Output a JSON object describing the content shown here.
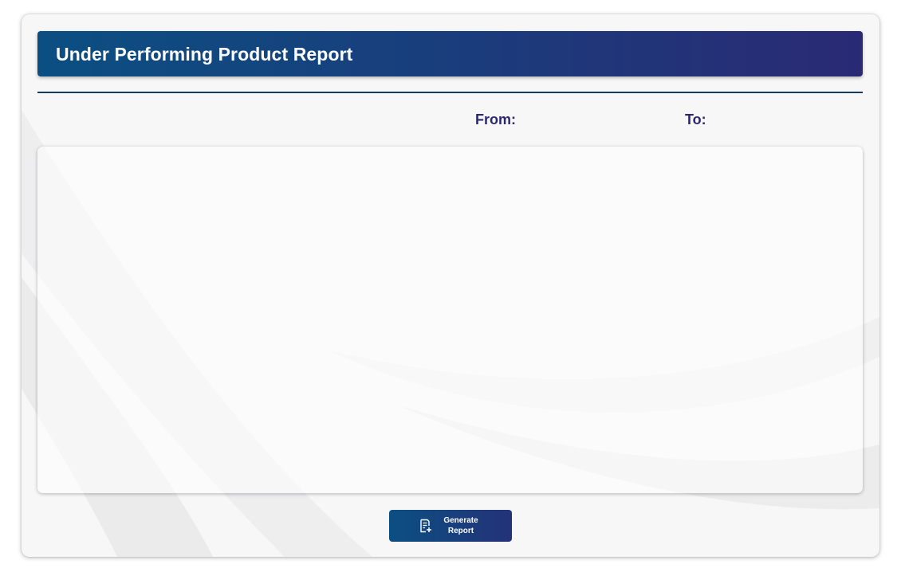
{
  "header": {
    "title": "Under Performing Product Report"
  },
  "filters": {
    "from_label": "From:",
    "to_label": "To:"
  },
  "actions": {
    "generate_line1": "Generate",
    "generate_line2": "Report",
    "generate_icon": "document-add-icon"
  },
  "colors": {
    "header_gradient_start": "#0b4f82",
    "header_gradient_end": "#2a2a74",
    "label_color": "#2b2870",
    "divider": "#123c66"
  }
}
